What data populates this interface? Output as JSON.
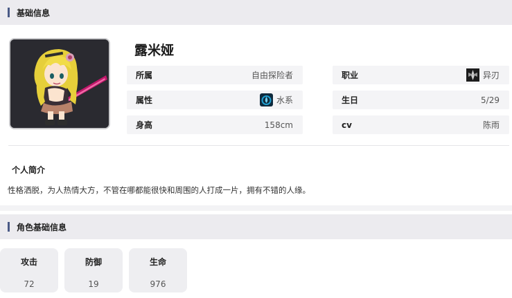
{
  "basic_info": {
    "section_title": "基础信息",
    "name": "露米娅",
    "fields": [
      {
        "label": "所属",
        "value": "自由探险者",
        "icon": ""
      },
      {
        "label": "职业",
        "value": "异刃",
        "icon": "blade-class-icon"
      },
      {
        "label": "属性",
        "value": "水系",
        "icon": "water-element-icon"
      },
      {
        "label": "生日",
        "value": "5/29",
        "icon": ""
      },
      {
        "label": "身高",
        "value": "158cm",
        "icon": ""
      },
      {
        "label": "cv",
        "value": "陈雨",
        "icon": ""
      }
    ]
  },
  "intro": {
    "title": "个人简介",
    "text": "性格洒脱，为人热情大方，不管在哪都能很快和周围的人打成一片，拥有不错的人缘。"
  },
  "stats": {
    "section_title": "角色基础信息",
    "items": [
      {
        "label": "攻击",
        "value": "72"
      },
      {
        "label": "防御",
        "value": "19"
      },
      {
        "label": "生命",
        "value": "976"
      }
    ]
  },
  "colors": {
    "header_bg": "#ecebef",
    "accent_bar": "#4a5a86",
    "cell_bg": "#f4f4f6",
    "water_icon": "#1e9fd1"
  }
}
